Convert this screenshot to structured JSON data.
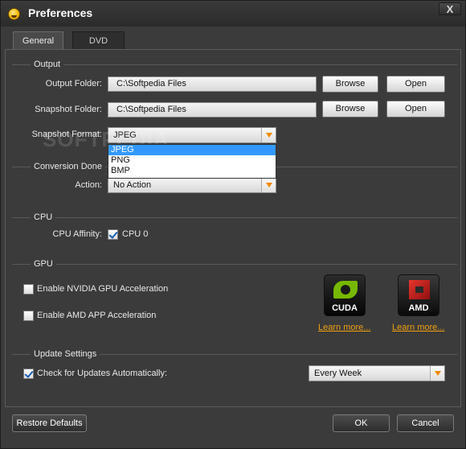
{
  "window": {
    "title": "Preferences",
    "close_glyph": "X"
  },
  "tabs": [
    {
      "label": "General",
      "active": true
    },
    {
      "label": "DVD",
      "active": false
    }
  ],
  "output": {
    "heading": "Output",
    "output_folder_label": "Output Folder:",
    "output_folder_value": "C:\\Softpedia Files",
    "snapshot_folder_label": "Snapshot Folder:",
    "snapshot_folder_value": "C:\\Softpedia Files",
    "browse_label": "Browse",
    "open_label": "Open",
    "snapshot_format_label": "Snapshot Format:",
    "snapshot_format_value": "JPEG",
    "snapshot_format_options": [
      "JPEG",
      "PNG",
      "BMP"
    ]
  },
  "conversion_done": {
    "heading": "Conversion Done",
    "action_label": "Action:",
    "action_value": "No Action"
  },
  "cpu": {
    "heading": "CPU",
    "affinity_label": "CPU Affinity:",
    "cpu0_label": "CPU 0",
    "cpu0_checked": true
  },
  "gpu": {
    "heading": "GPU",
    "nvidia_label": "Enable NVIDIA GPU Acceleration",
    "nvidia_checked": false,
    "amd_label": "Enable AMD APP Acceleration",
    "amd_checked": false,
    "cuda_logo_text": "CUDA",
    "amd_logo_text": "AMD",
    "learn_more_label": "Learn more...",
    "link_color": "#f0a010"
  },
  "updates": {
    "heading": "Update Settings",
    "check_label": "Check for Updates Automatically:",
    "check_checked": true,
    "frequency_value": "Every Week"
  },
  "footer": {
    "restore_label": "Restore Defaults",
    "ok_label": "OK",
    "cancel_label": "Cancel"
  },
  "watermark": "SOFTPEDIA",
  "colors": {
    "accent_arrow": "#f08a00",
    "selection": "#3399ff"
  },
  "icons": [
    "app-icon",
    "close-icon",
    "chevron-down-icon",
    "checkmark-icon",
    "nvidia-cuda-logo",
    "amd-logo"
  ]
}
